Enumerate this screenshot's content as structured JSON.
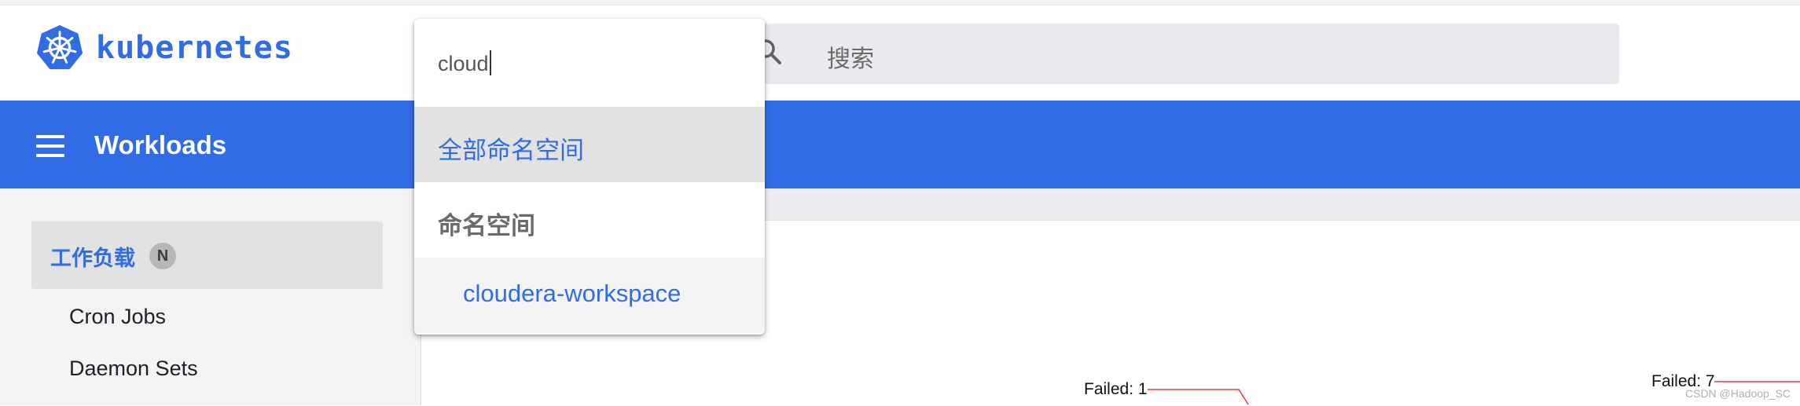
{
  "header": {
    "brand": "kubernetes",
    "search_placeholder": "搜索"
  },
  "toolbar": {
    "title": "Workloads"
  },
  "namespace_dropdown": {
    "input_value": "cloud",
    "options": [
      {
        "label": "全部命名空间",
        "selected": true
      },
      {
        "label": "命名空间",
        "is_header": true
      },
      {
        "label": "cloudera-workspace"
      }
    ]
  },
  "sidebar": {
    "group": {
      "label": "工作负载",
      "badge": "N"
    },
    "items": [
      {
        "label": "Cron Jobs"
      },
      {
        "label": "Daemon Sets"
      }
    ]
  },
  "charts": {
    "label_1": "Failed: 1",
    "label_2": "Failed: 7"
  },
  "watermark": "CSDN @Hadoop_SC",
  "colors": {
    "accent": "#326ce5",
    "chart_line": "#e53935"
  }
}
